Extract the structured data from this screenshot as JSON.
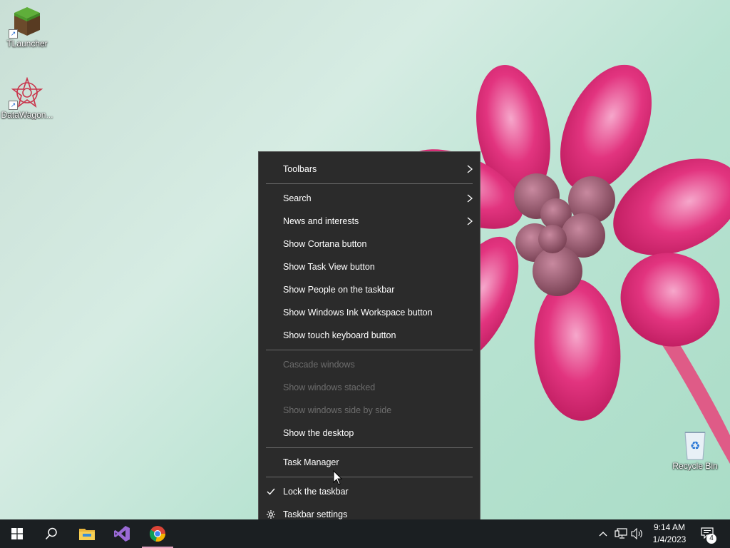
{
  "desktop": {
    "icons": [
      {
        "label": "TLauncher",
        "icon": "minecraft-grass-block-icon"
      },
      {
        "label": "DataWagon...",
        "icon": "datawagon-logo-icon"
      },
      {
        "label": "Recycle Bin",
        "icon": "recycle-bin-icon"
      }
    ]
  },
  "menu": {
    "items": [
      {
        "label": "Toolbars",
        "submenu": true
      },
      {
        "label": "Search",
        "submenu": true
      },
      {
        "label": "News and interests",
        "submenu": true
      },
      {
        "label": "Show Cortana button"
      },
      {
        "label": "Show Task View button"
      },
      {
        "label": "Show People on the taskbar"
      },
      {
        "label": "Show Windows Ink Workspace button"
      },
      {
        "label": "Show touch keyboard button"
      },
      {
        "label": "Cascade windows",
        "disabled": true
      },
      {
        "label": "Show windows stacked",
        "disabled": true
      },
      {
        "label": "Show windows side by side",
        "disabled": true
      },
      {
        "label": "Show the desktop"
      },
      {
        "label": "Task Manager"
      },
      {
        "label": "Lock the taskbar",
        "checked": true
      },
      {
        "label": "Taskbar settings",
        "icon": "gear-icon"
      }
    ]
  },
  "taskbar": {
    "apps": [
      "start-icon",
      "search-icon",
      "file-explorer-icon",
      "visual-studio-icon",
      "chrome-icon"
    ],
    "clock": {
      "time": "9:14 AM",
      "date": "1/4/2023"
    },
    "notification_count": "4"
  },
  "colors": {
    "menu_bg": "#2b2b2b",
    "taskbar_bg": "#1b1f22",
    "flower_pink": "#e2347f",
    "wallpaper_mint": "#b9e3d2"
  }
}
